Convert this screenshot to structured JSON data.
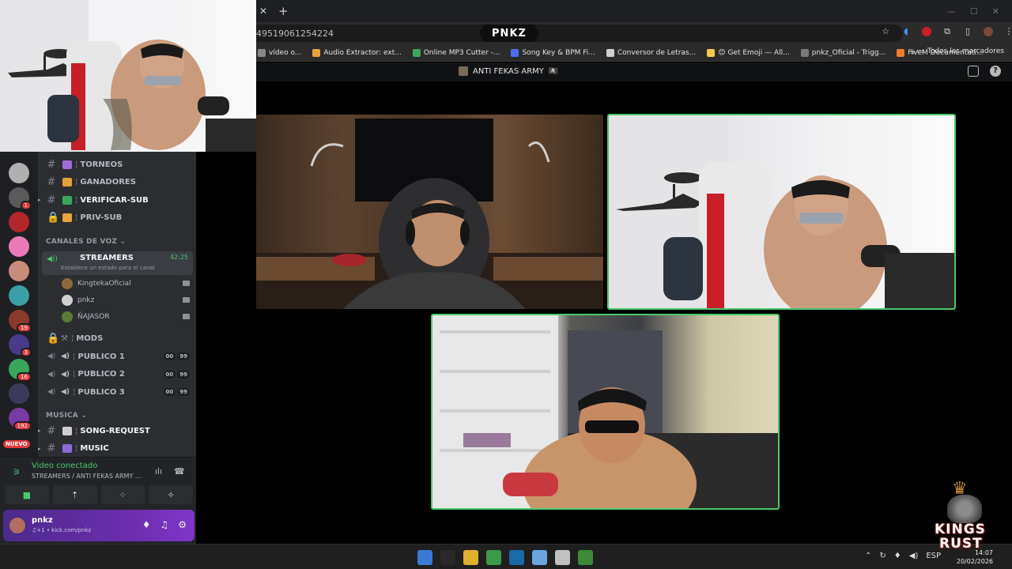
{
  "browser": {
    "url_fragment": "49519061254224",
    "page_logo": "PNKZ",
    "bookmarks": [
      {
        "label": "vídeo o...",
        "color": "#888888"
      },
      {
        "label": "Audio Extractor: ext...",
        "color": "#e8a33d"
      },
      {
        "label": "Online MP3 Cutter -...",
        "color": "#3ca55c"
      },
      {
        "label": "Song Key & BPM Fi...",
        "color": "#4a6cf7"
      },
      {
        "label": "Conversor de Letras...",
        "color": "#cfcfcf"
      },
      {
        "label": "😊 Get Emoji — All...",
        "color": "#f2c94c"
      },
      {
        "label": "pnkz_Oficial - Trigg...",
        "color": "#7a7a7a"
      },
      {
        "label": "FiveM Documentati...",
        "color": "#f07c2b"
      }
    ],
    "all_bookmarks_label": "Todos los marcadores",
    "more_glyph": "»"
  },
  "discord": {
    "header": {
      "channel_name": "ANTI FEKAS ARMY",
      "flag": "🏴‍☠"
    },
    "channels": {
      "text_top": [
        {
          "name": "TORNEOS",
          "emoji_color": "#a06bd5",
          "strong": false,
          "arrow": false,
          "lock": false
        },
        {
          "name": "GANADORES",
          "emoji_color": "#e0a23a",
          "strong": false,
          "arrow": false,
          "lock": false
        },
        {
          "name": "VERIFICAR-SUB",
          "emoji_color": "#3ba55c",
          "strong": true,
          "arrow": true,
          "lock": false
        },
        {
          "name": "PRIV-SUB",
          "emoji_color": "#e8a33d",
          "strong": false,
          "arrow": false,
          "lock": true
        }
      ],
      "voice_category": "CANALES DE VOZ",
      "voice_channel": {
        "name": "STREAMERS",
        "time": "42:25",
        "status": "Establece un estado para el canal"
      },
      "users": [
        {
          "name": "KingtekaOficial",
          "color": "#8a6a3a"
        },
        {
          "name": "pnkz",
          "color": "#cfcfcf"
        },
        {
          "name": "ÑAJASOR",
          "color": "#5a7a3a"
        }
      ],
      "mods_label": "MODS",
      "publicos": [
        {
          "name": "PUBLICO 1",
          "a": "00",
          "b": "99"
        },
        {
          "name": "PUBLICO 2",
          "a": "00",
          "b": "99"
        },
        {
          "name": "PUBLICO 3",
          "a": "00",
          "b": "99"
        }
      ],
      "music_category": "MUSICA",
      "music_channels": [
        {
          "name": "SONG-REQUEST",
          "emoji_color": "#cfcfcf"
        },
        {
          "name": "MUSIC",
          "emoji_color": "#8a6ad5"
        }
      ]
    },
    "servers": [
      {
        "color": "#b0b0b0",
        "badge": ""
      },
      {
        "color": "#5a5a5a",
        "badge": "1"
      },
      {
        "color": "#b3262a",
        "badge": ""
      },
      {
        "color": "#e97ab8",
        "badge": ""
      },
      {
        "color": "#c98b7a",
        "badge": ""
      },
      {
        "color": "#3aa0a5",
        "badge": ""
      },
      {
        "color": "#8a3a2a",
        "badge": "19"
      },
      {
        "color": "#4a3a8a",
        "badge": "3"
      },
      {
        "color": "#3ba55c",
        "badge": "16"
      },
      {
        "color": "#3a3a5a",
        "badge": ""
      },
      {
        "color": "#7a3aa5",
        "badge": "192"
      }
    ],
    "new_badge": "NUEVO",
    "voice_panel": {
      "status": "Video conectado",
      "channel": "STREAMERS / ANTI FEKAS ARMY ..."
    },
    "user": {
      "name": "pnkz",
      "sub": "♫+1 • kick.com/pnkz"
    }
  },
  "taskbar": {
    "apps": [
      "#3a7bd5",
      "#2a2a2a",
      "#e0b030",
      "#3a9a4a",
      "#1a6aa5",
      "#6aa5e0",
      "#c0c0c0",
      "#3a8a3a"
    ],
    "lang": "ESP",
    "time": "14:07",
    "date": "20/02/2026"
  },
  "watermark": {
    "line1": "KINGS",
    "line2": "RUST"
  }
}
